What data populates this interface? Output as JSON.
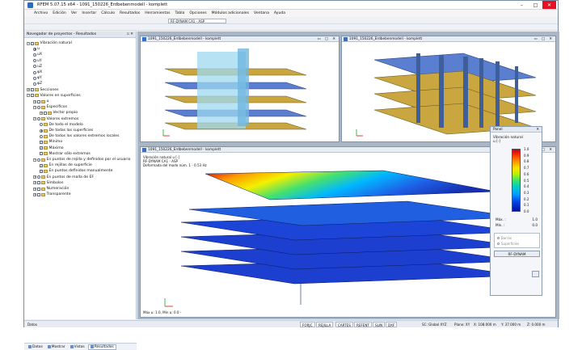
{
  "window": {
    "title": "RFEM 5.07.15 x64 - 1091_150226_Erdbebenmodell - komplett",
    "controls": [
      "–",
      "□",
      "✕"
    ]
  },
  "menu": [
    "Archivo",
    "Edición",
    "Ver",
    "Insertar",
    "Cálculo",
    "Resultados",
    "Herramientas",
    "Tabla",
    "Opciones",
    "Módulos adicionales",
    "Ventana",
    "Ayuda"
  ],
  "toolbar": {
    "loadcase_combo": "RF-DYNAM CA1 - ASP",
    "colors": {
      "accent": "#2e6bbd",
      "close": "#e81123"
    }
  },
  "navigator": {
    "title": "Navegador de proyectos - Resultados",
    "pin": "▫ ✕",
    "items": [
      {
        "label": "Vibración natural",
        "level": 0,
        "ctrl": "exp-chk",
        "state": "−",
        "folder": true
      },
      {
        "label": "u",
        "level": 1,
        "ctrl": "rad",
        "on": true
      },
      {
        "label": "uX",
        "level": 1,
        "ctrl": "rad"
      },
      {
        "label": "uY",
        "level": 1,
        "ctrl": "rad"
      },
      {
        "label": "uZ",
        "level": 1,
        "ctrl": "rad"
      },
      {
        "label": "φX",
        "level": 1,
        "ctrl": "rad"
      },
      {
        "label": "φY",
        "level": 1,
        "ctrl": "rad"
      },
      {
        "label": "φZ",
        "level": 1,
        "ctrl": "rad"
      },
      {
        "label": "Secciones",
        "level": 0,
        "ctrl": "exp-chk",
        "state": "+",
        "folder": true
      },
      {
        "label": "Valores en superficies",
        "level": 0,
        "ctrl": "exp-chk",
        "state": "−",
        "folder": true
      },
      {
        "label": "u",
        "level": 1,
        "ctrl": "exp-chk",
        "state": "+",
        "folder": true
      },
      {
        "label": "Específicos",
        "level": 1,
        "ctrl": "exp-rad",
        "state": "−",
        "folder": true
      },
      {
        "label": "Vector propio",
        "level": 2,
        "ctrl": "exp-chk",
        "state": "+",
        "folder": true
      },
      {
        "label": "Valores extremos",
        "level": 1,
        "ctrl": "exp-rad",
        "state": "−",
        "folder": true
      },
      {
        "label": "De todo el modelo",
        "level": 2,
        "ctrl": "rad",
        "folder": true
      },
      {
        "label": "De todas las superficies",
        "level": 2,
        "ctrl": "rad",
        "on": true,
        "folder": true
      },
      {
        "label": "De todos los valores extremos locales",
        "level": 2,
        "ctrl": "rad",
        "folder": true
      },
      {
        "label": "Mínimo",
        "level": 2,
        "ctrl": "chk",
        "checked": true,
        "folder": true
      },
      {
        "label": "Máximo",
        "level": 2,
        "ctrl": "chk",
        "checked": true,
        "folder": true
      },
      {
        "label": "Mostrar sólo extremos",
        "level": 2,
        "ctrl": "chk",
        "folder": true
      },
      {
        "label": "En puntos de rejilla y definidos por el usuario",
        "level": 1,
        "ctrl": "exp-rad",
        "state": "−",
        "folder": true
      },
      {
        "label": "En rejillas de superficie",
        "level": 2,
        "ctrl": "chk",
        "checked": true,
        "folder": true
      },
      {
        "label": "En puntos definidos manualmente",
        "level": 2,
        "ctrl": "chk",
        "checked": true,
        "folder": true
      },
      {
        "label": "En puntos de malla de EF",
        "level": 1,
        "ctrl": "exp-rad",
        "state": "+",
        "folder": true
      },
      {
        "label": "Símbolos",
        "level": 1,
        "ctrl": "exp-chk",
        "state": "+",
        "folder": true
      },
      {
        "label": "Numeración",
        "level": 1,
        "ctrl": "exp-chk",
        "state": "+",
        "folder": true
      },
      {
        "label": "Transparente",
        "level": 1,
        "ctrl": "exp-chk",
        "state": "+",
        "folder": true
      }
    ],
    "tabs": [
      "Datos",
      "Mostrar",
      "Vistas",
      "Resultados"
    ]
  },
  "views": {
    "w1_title": "1091_150226_Erdbebenmodell - komplett",
    "w2_title": "1091_150226_Erdbebenmodell - komplett",
    "w3_title": "1091_150226_Erdbebenmodell - komplett",
    "wbtns": "▭ □ ✕",
    "info": [
      "Vibración natural u [-]",
      "RF-DYNAM CA1 - ASP",
      "Deformada del modo núm. 1 - 0.53 Hz"
    ],
    "footnote": "Máx u: 1.0, Mín u: 0.0 -",
    "axis_x": "X",
    "axis_z": "Z"
  },
  "panel": {
    "title": "Panel",
    "close": "✕",
    "heading": [
      "Vibración natural",
      "u [-]"
    ],
    "scale": [
      "1.0",
      "0.9",
      "0.8",
      "0.7",
      "0.6",
      "0.5",
      "0.4",
      "0.3",
      "0.2",
      "0.1",
      "0.0"
    ],
    "max_label": "Máx. :",
    "max_value": "1.0",
    "min_label": "Mín. :",
    "min_value": "0.0",
    "option_bars": "Barras",
    "option_surfaces": "Superficies",
    "button": "RF-DYNAM"
  },
  "status": {
    "left": "Datos",
    "buttons": [
      "FORJC",
      "REJILLA",
      "CARTES",
      "REFENT",
      "SLIN",
      "DXF"
    ],
    "cs": "SC: Global XYZ",
    "plane": "Plano: XY",
    "x": "X: 108.000 m",
    "y": "Y: 37.000 m",
    "z": "Z: 0.000 m"
  }
}
